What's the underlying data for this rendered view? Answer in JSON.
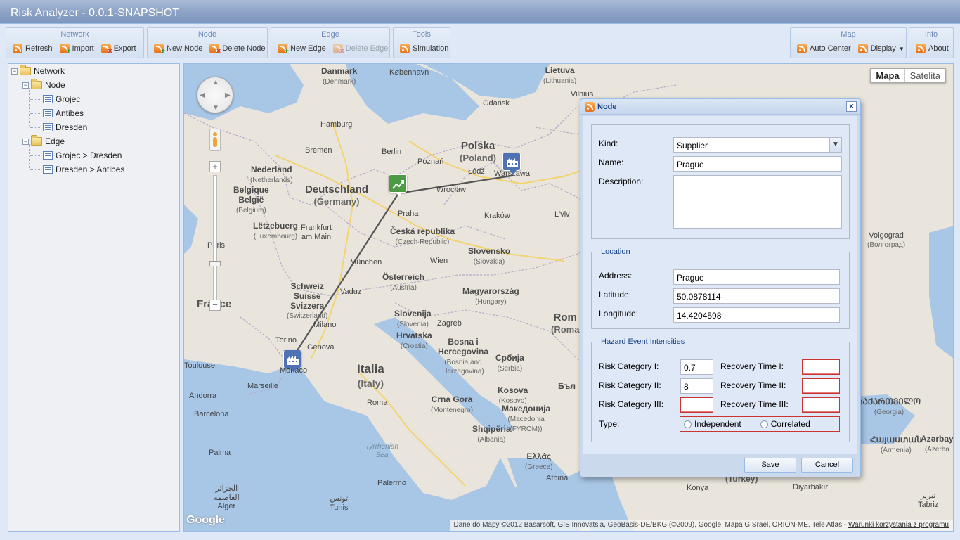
{
  "app": {
    "title": "Risk Analyzer - 0.0.1-SNAPSHOT"
  },
  "toolbar": {
    "network": {
      "title": "Network",
      "refresh": "Refresh",
      "import": "Import",
      "export": "Export"
    },
    "node": {
      "title": "Node",
      "new_node": "New Node",
      "delete_node": "Delete Node"
    },
    "edge": {
      "title": "Edge",
      "new_edge": "New Edge",
      "delete_edge": "Delete Edge"
    },
    "tools": {
      "title": "Tools",
      "simulation": "Simulation"
    },
    "map": {
      "title": "Map",
      "auto_center": "Auto Center",
      "display": "Display"
    },
    "info": {
      "title": "Info",
      "about": "About"
    }
  },
  "tree": {
    "root": "Network",
    "node_folder": "Node",
    "nodes": [
      "Grojec",
      "Antibes",
      "Dresden"
    ],
    "edge_folder": "Edge",
    "edges": [
      "Grojec > Dresden",
      "Dresden > Antibes"
    ]
  },
  "map": {
    "type_map": "Mapa",
    "type_satellite": "Satelita",
    "google": "Google",
    "attribution": "Dane do Mapy ©2012 Basarsoft, GIS Innovatsia, GeoBasis-DE/BKG (©2009), Google, Mapa GISrael, ORION-ME, Tele Atlas - ",
    "terms_link": "Warunki korzystania z programu",
    "labels": {
      "danmark": "Danmark",
      "danmark_sub": "(Denmark)",
      "kobenhavn": "København",
      "lietuva": "Lietuva",
      "lietuva_sub": "(Lithuania)",
      "vilnius": "Vilnius",
      "gdansk": "Gdańsk",
      "hamburg": "Hamburg",
      "bremen": "Bremen",
      "berlin": "Berlin",
      "poznan": "Poznań",
      "polska": "Polska",
      "polska_sub": "(Poland)",
      "lodz": "Łódź",
      "warszawa": "Warszawa",
      "nederland": "Nederland",
      "nederland_sub": "(Netherlands)",
      "deutschland": "Deutschland",
      "deutschland_sub": "(Germany)",
      "belgique": "Belgique",
      "belgie": "België",
      "belgium": "(Belgium)",
      "wroclaw": "Wrocław",
      "praha": "Praha",
      "krakow": "Kraków",
      "lviv": "L'viv",
      "letzebuerg": "Lëtzebuerg",
      "letzebuerg_sub": "(Luxembourg)",
      "frankfurt": "Frankfurt",
      "frankfurt2": "am Main",
      "ceska": "Česká republika",
      "ceska_sub": "(Czech Republic)",
      "paris": "Paris",
      "munchen": "München",
      "slovensko": "Slovensko",
      "slovensko_sub": "(Slovakia)",
      "wien": "Wien",
      "osterreich": "Österreich",
      "osterreich_sub": "(Austria)",
      "schweiz": "Schweiz",
      "suisse": "Suisse",
      "svizzera": "Svizzera",
      "switzerland": "(Switzerland)",
      "vaduz": "Vaduz",
      "magyarorszag": "Magyarország",
      "magyarorszag_sub": "(Hungary)",
      "france": "France",
      "milano": "Milano",
      "torino": "Torino",
      "genova": "Genova",
      "monaco": "Monaco",
      "toulouse": "Toulouse",
      "marseille": "Marseille",
      "slovenija": "Slovenija",
      "slovenija_sub": "(Slovenia)",
      "zagreb": "Zagreb",
      "hrvatska": "Hrvatska",
      "hrvatska_sub": "(Croatia)",
      "bosna1": "Bosna i",
      "bosna2": "Hercegovina",
      "bosna_sub1": "(Bosnia and",
      "bosna_sub2": "Herzegovina)",
      "srbija": "Србија",
      "srbija_sub": "(Serbia)",
      "italia": "Italia",
      "italia_sub": "(Italy)",
      "roma": "Roma",
      "crna": "Crna Gora",
      "crna_sub": "(Montenegro)",
      "kosova": "Kosova",
      "kosovo": "(Kosovo)",
      "makedonija": "Македонија",
      "makedonija_sub1": "(Macedonia",
      "makedonija_sub2": "(FYROM))",
      "shqiperia": "Shqipëria",
      "shqiperia_sub": "(Albania)",
      "andorra": "Andorra",
      "barcelona": "Barcelona",
      "palma": "Palma",
      "tyrrhenian1": "Tyrrhenian",
      "tyrrhenian2": "Sea",
      "palermo": "Palermo",
      "tunis": "Tunis",
      "tunis_ar": "تونس",
      "alger_ar1": "الجزائر",
      "alger_ar2": "العاصمة",
      "alger": "Alger",
      "ellas": "Ελλάς",
      "ellas_sub": "(Greece)",
      "athina": "Athina",
      "rom_partial": "Rom",
      "rom_partial_sub": "(Roma",
      "bul_partial": "Бъл",
      "volgograd": "Volgograd",
      "volgograd_sub": "(Волгоград)",
      "georgia": "ᲡᲐᲥᲐᲠᲗᲕᲔᲚᲝ",
      "georgia_sub": "(Georgia)",
      "armenia": "Հայաստան",
      "armenia_sub": "(Armenia)",
      "azerbay": "Azərbay",
      "azerbay_sub": "(Azerba",
      "turkey": "(Turkey)",
      "konya": "Konya",
      "diyarbakir": "Diyarbakır",
      "tabriz": "Tabriz",
      "tabriz_fa": "تبریز"
    }
  },
  "dialog": {
    "title": "Node",
    "kind_label": "Kind:",
    "kind_value": "Supplier",
    "name_label": "Name:",
    "name_value": "Prague",
    "description_label": "Description:",
    "description_value": "",
    "location_legend": "Location",
    "address_label": "Address:",
    "address_value": "Prague",
    "latitude_label": "Latitude:",
    "latitude_value": "50.0878114",
    "longitude_label": "Longitude:",
    "longitude_value": "14.4204598",
    "hazard_legend": "Hazard Event Intensities",
    "risk1_label": "Risk Category I:",
    "risk1_value": "0.7",
    "risk2_label": "Risk Category II:",
    "risk2_value": "8",
    "risk3_label": "Risk Category III:",
    "risk3_value": "",
    "recovery1_label": "Recovery Time I:",
    "recovery1_value": "",
    "recovery2_label": "Recovery Time II:",
    "recovery2_value": "",
    "recovery3_label": "Recovery Time III:",
    "recovery3_value": "",
    "type_label": "Type:",
    "type_independent": "Independent",
    "type_correlated": "Correlated",
    "save": "Save",
    "cancel": "Cancel"
  }
}
